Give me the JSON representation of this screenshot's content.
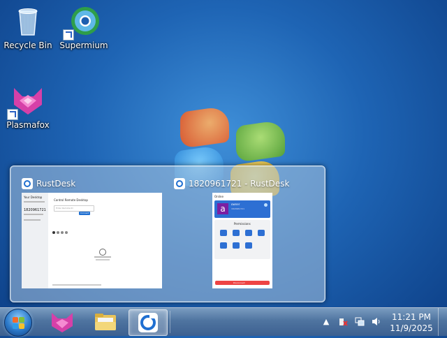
{
  "desktop": {
    "icons": [
      {
        "label": "Recycle Bin",
        "icon": "recycle-bin-icon"
      },
      {
        "label": "Supermium",
        "icon": "supermium-icon"
      },
      {
        "label": "Plasmafox",
        "icon": "plasmafox-icon"
      }
    ]
  },
  "switcher": {
    "windows": [
      {
        "title": "RustDesk",
        "icon": "rustdesk-icon"
      },
      {
        "title": "1820961721 - RustDesk",
        "icon": "rustdesk-icon"
      }
    ],
    "rustdesk_main": {
      "sidebar_heading": "Your Desktop",
      "id_value": "1820961721",
      "control_heading": "Control Remote Desktop",
      "input_placeholder": "Enter Remote ID",
      "connect_label": "Connect"
    },
    "rustdesk_cm": {
      "header": "Online",
      "avatar_letter": "a",
      "user_name": "owner",
      "user_id": "1820961721",
      "permissions_label": "Permissions",
      "disconnect_label": "Disconnect"
    }
  },
  "taskbar": {
    "pinned": [
      {
        "name": "start-button"
      },
      {
        "name": "plasmafox-taskbar"
      },
      {
        "name": "file-explorer-taskbar"
      },
      {
        "name": "rustdesk-taskbar"
      }
    ],
    "clock": {
      "time": "11:21 PM",
      "date": "11/9/2025"
    }
  },
  "colors": {
    "accent": "#1f6fd1",
    "plasmafox": "#d640a8"
  }
}
